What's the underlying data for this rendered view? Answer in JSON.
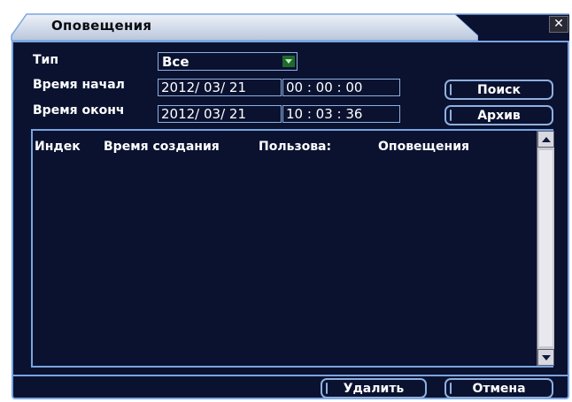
{
  "window": {
    "title": "Оповещения",
    "close_label": "✕"
  },
  "filters": {
    "type_label": "Тип",
    "type_value": "Все",
    "start_label": "Время начал",
    "start_date": "2012/ 03/ 21",
    "start_time": "00 : 00 : 00",
    "end_label": "Время оконч",
    "end_date": "2012/ 03/ 21",
    "end_time": "10 : 03 : 36"
  },
  "buttons": {
    "search": "Поиск",
    "archive": "Архив",
    "delete": "Удалить",
    "cancel": "Отмена"
  },
  "table": {
    "columns": [
      "Индек",
      "Время создания",
      "Пользова:",
      "Оповещения"
    ],
    "rows": []
  },
  "colors": {
    "panel_bg": "#0a1230",
    "border": "#7aa4e0",
    "title_bar": "#c8d4e6"
  }
}
